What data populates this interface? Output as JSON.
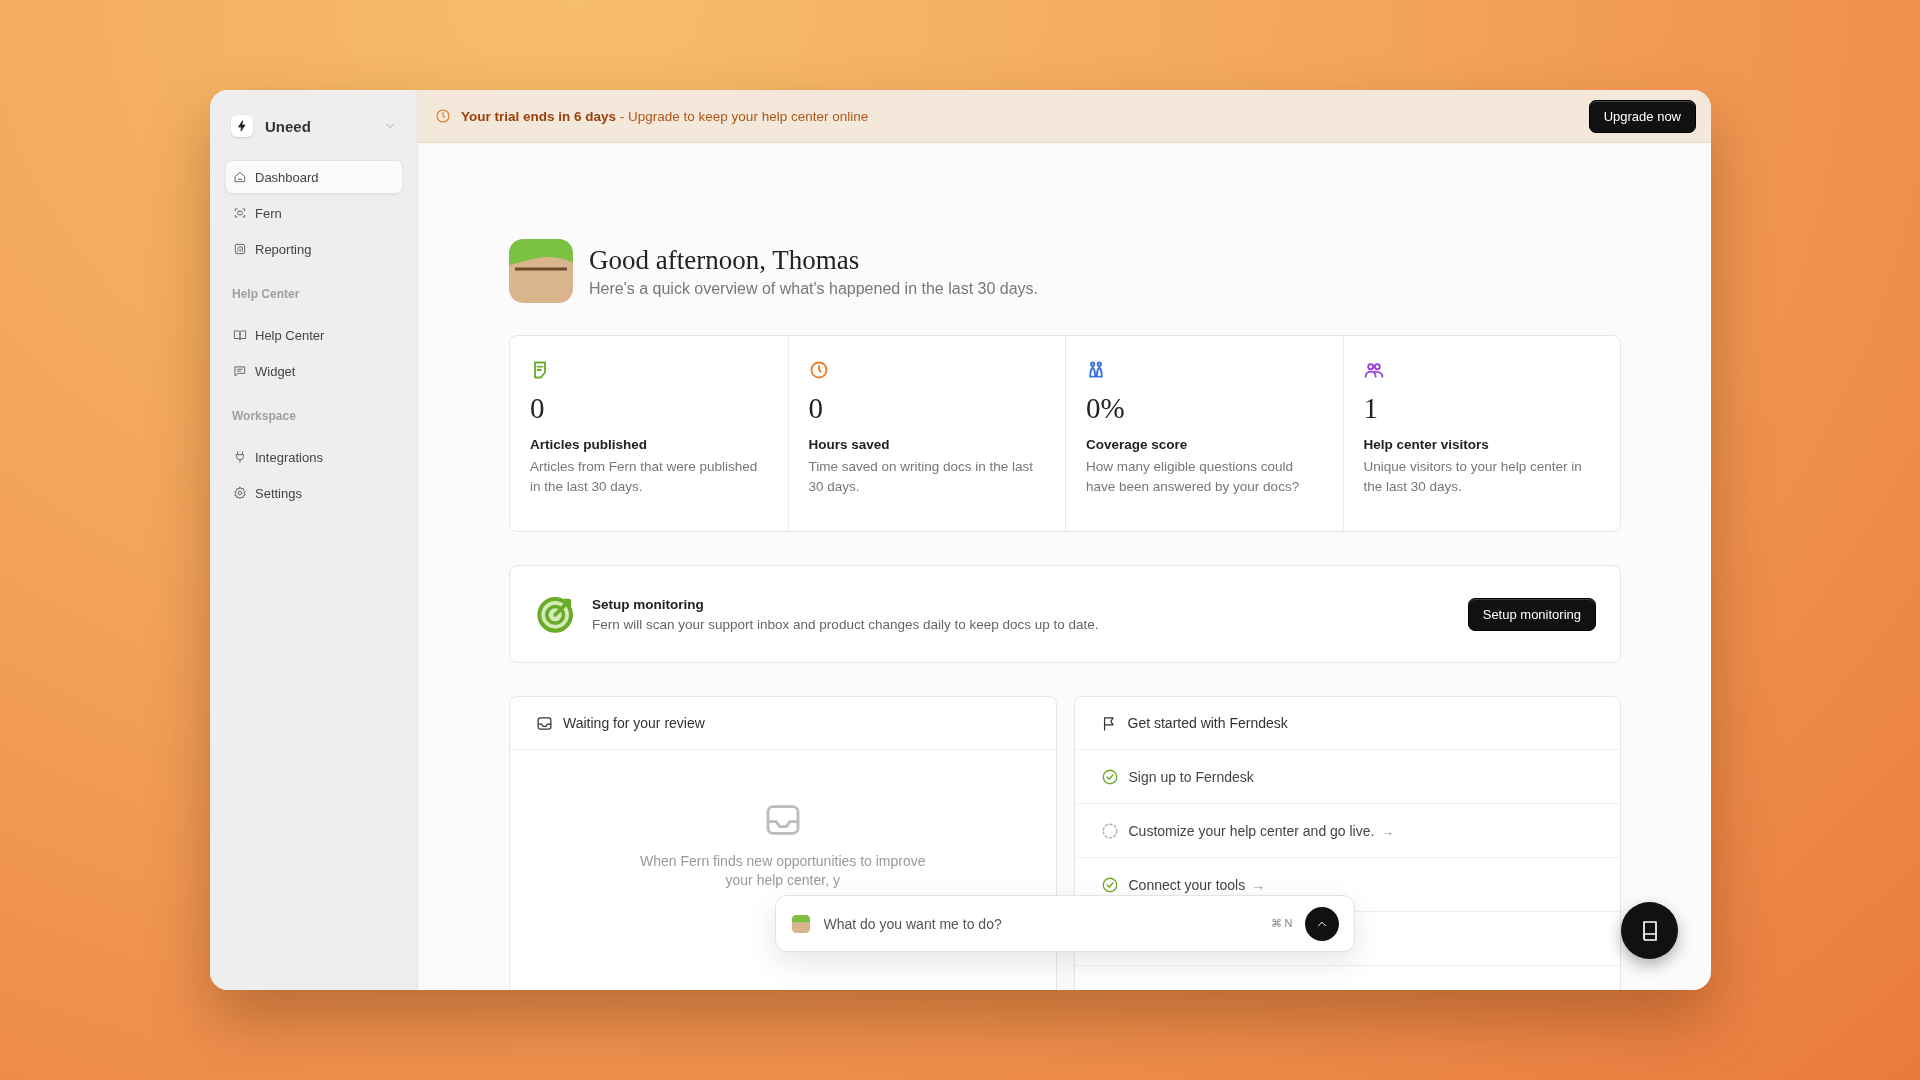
{
  "workspace": {
    "name": "Uneed"
  },
  "sidebar": {
    "sections": [
      {
        "items": [
          {
            "label": "Dashboard",
            "selected": true
          },
          {
            "label": "Fern",
            "selected": false
          },
          {
            "label": "Reporting",
            "selected": false
          }
        ]
      },
      {
        "heading": "Help Center",
        "items": [
          {
            "label": "Help Center",
            "selected": false
          },
          {
            "label": "Widget",
            "selected": false
          }
        ]
      },
      {
        "heading": "Workspace",
        "items": [
          {
            "label": "Integrations",
            "selected": false
          },
          {
            "label": "Settings",
            "selected": false
          }
        ]
      }
    ]
  },
  "banner": {
    "message": "**Your trial ends in 6 days** - Upgrade to keep your help center online",
    "button": "Upgrade now"
  },
  "greeting": {
    "title": "Good afternoon, Thomas",
    "subtitle": "Here's a quick overview of what's happened in the last 30 days."
  },
  "stats": [
    {
      "value": "0",
      "label": "Articles published",
      "description": "Articles from Fern that were published in the last 30 days.",
      "color": "#6aab2a"
    },
    {
      "value": "0",
      "label": "Hours saved",
      "description": "Time saved on writing docs in the last 30 days.",
      "color": "#ea7a2a"
    },
    {
      "value": "0%",
      "label": "Coverage score",
      "description": "How many eligible questions could have been answered by your docs?",
      "color": "#3b6fe0"
    },
    {
      "value": "1",
      "label": "Help center visitors",
      "description": "Unique visitors to your help center in the last 30 days.",
      "color": "#9b3fe0"
    }
  ],
  "monitoring": {
    "title": "Setup monitoring",
    "description": "Fern will scan your support inbox and product changes daily to keep docs up to date.",
    "button": "Setup monitoring"
  },
  "review": {
    "title": "Waiting for your review",
    "empty_text": "When Fern finds new opportunities to improve your help center, y"
  },
  "checklist": {
    "title": "Get started with Ferndesk",
    "items": [
      {
        "label": "Sign up to Ferndesk",
        "checked": true
      },
      {
        "label": "Customize your help center and go live.",
        "checked": false,
        "arrow": "→"
      },
      {
        "label": "Connect your tools",
        "checked": true,
        "arrow": "→"
      }
    ]
  },
  "chat": {
    "placeholder": "What do you want me to do?",
    "shortcut": "⌘ N"
  }
}
